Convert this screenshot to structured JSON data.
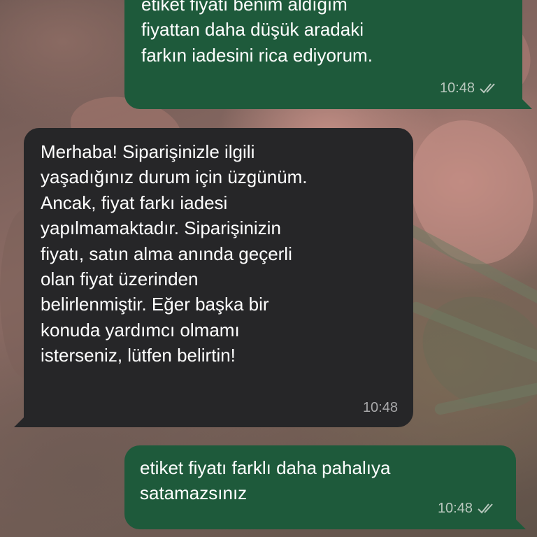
{
  "messages": [
    {
      "direction": "outgoing",
      "text": "etiket fiyatı benim aldığım\nfiyattan daha düşük aradaki\nfarkın iadesini rica ediyorum.",
      "time": "10:48",
      "status": "read",
      "status_icon": "double-check-icon"
    },
    {
      "direction": "incoming",
      "text": "Merhaba! Siparişinizle ilgili\nyaşadığınız durum için üzgünüm.\nAncak, fiyat farkı iadesi\nyapılmamaktadır. Siparişinizin\nfiyatı, satın alma anında geçerli\nolan fiyat üzerinden\nbelirlenmiştir. Eğer başka bir\nkonuda yardımcı olmamı\nisterseniz, lütfen belirtin!",
      "time": "10:48"
    },
    {
      "direction": "outgoing",
      "text": "etiket fiyatı farklı daha pahalıya\nsatamazsınız",
      "time": "10:48",
      "status": "read",
      "status_icon": "double-check-icon"
    }
  ],
  "colors": {
    "outgoing_bubble": "#1e5a3b",
    "incoming_bubble": "#262628",
    "text": "#ffffff",
    "meta_outgoing": "#b8c7bd",
    "meta_incoming": "#a8a8aa"
  }
}
